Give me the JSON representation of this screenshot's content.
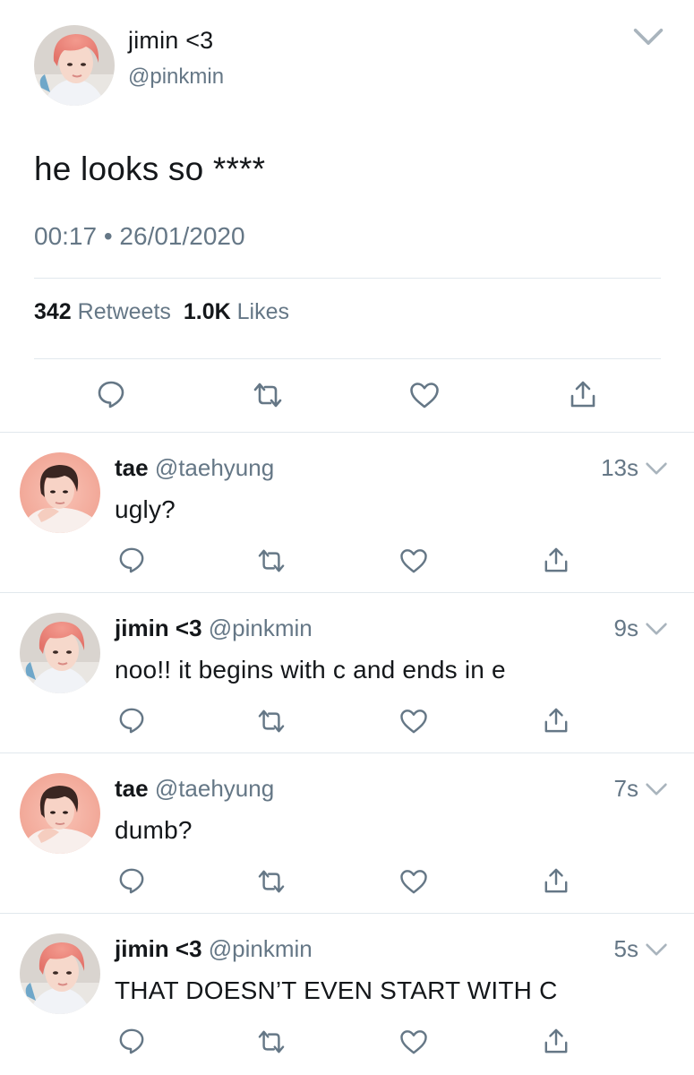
{
  "main_tweet": {
    "display_name": "jimin <3",
    "handle": "@pinkmin",
    "text": "he looks so ****",
    "timestamp": "00:17 • 26/01/2020",
    "retweet_count": "342",
    "retweet_label": "Retweets",
    "like_count": "1.0K",
    "like_label": "Likes",
    "actions": [
      "reply-icon",
      "retweet-icon",
      "like-icon",
      "share-icon"
    ]
  },
  "replies": [
    {
      "display_name": "tae",
      "handle": "@taehyung",
      "time": "13s",
      "text": "ugly?"
    },
    {
      "display_name": "jimin <3",
      "handle": "@pinkmin",
      "time": "9s",
      "text": "noo!! it begins with c and ends in e"
    },
    {
      "display_name": "tae",
      "handle": "@taehyung",
      "time": "7s",
      "text": "dumb?"
    },
    {
      "display_name": "jimin <3",
      "handle": "@pinkmin",
      "time": "5s",
      "text": "THAT DOESN’T EVEN START WITH C"
    }
  ],
  "colors": {
    "text_primary": "#14171a",
    "text_secondary": "#657786",
    "icon": "#657786",
    "divider": "#e1e8ed"
  }
}
